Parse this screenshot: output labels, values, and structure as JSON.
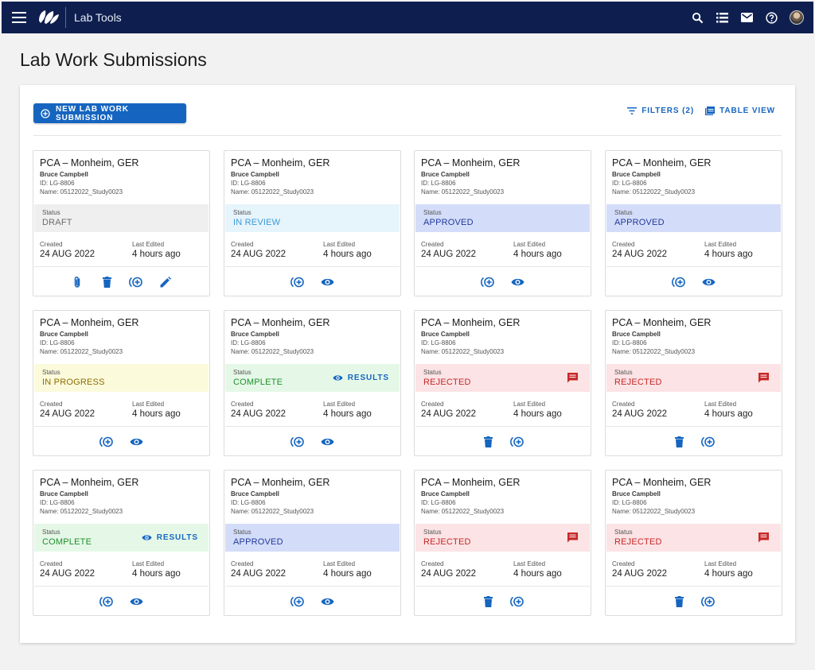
{
  "app": {
    "name": "Lab Tools",
    "menu_icon": "hamburger-menu-icon",
    "logo_icon": "leaf-logo-icon",
    "header_icons": [
      "search-icon",
      "list-icon",
      "mail-icon",
      "help-icon",
      "avatar"
    ]
  },
  "page": {
    "title": "Lab Work Submissions"
  },
  "toolbar": {
    "new_label": "NEW LAB WORK SUBMISSION",
    "filters_label": "FILTERS (2)",
    "table_view_label": "TABLE VIEW"
  },
  "labels": {
    "status": "Status",
    "created": "Created",
    "last_edited": "Last Edited",
    "results": "RESULTS"
  },
  "colors": {
    "header_bg": "#0e1f4f",
    "accent": "#1565c0",
    "draft": "#efefef",
    "in_review": "#e6f4fc",
    "approved": "#d3ddf9",
    "in_progress": "#fbfbdc",
    "complete": "#e5f8e7",
    "rejected": "#fce3e5"
  },
  "cards": [
    {
      "title": "PCA – Monheim, GER",
      "owner": "Bruce Campbell",
      "id": "ID: LG-8806",
      "name": "Name: 05122022_Study0023",
      "status": "DRAFT",
      "created": "24 AUG 2022",
      "last_edited": "4 hours ago",
      "actions": [
        "attach-icon",
        "delete-icon",
        "add-reviewer-icon",
        "edit-icon"
      ]
    },
    {
      "title": "PCA – Monheim, GER",
      "owner": "Bruce Campbell",
      "id": "ID: LG-8806",
      "name": "Name: 05122022_Study0023",
      "status": "IN REVIEW",
      "created": "24 AUG 2022",
      "last_edited": "4 hours ago",
      "actions": [
        "add-reviewer-icon",
        "view-icon"
      ]
    },
    {
      "title": "PCA – Monheim, GER",
      "owner": "Bruce Campbell",
      "id": "ID: LG-8806",
      "name": "Name: 05122022_Study0023",
      "status": "APPROVED",
      "created": "24 AUG 2022",
      "last_edited": "4 hours ago",
      "actions": [
        "add-reviewer-icon",
        "view-icon"
      ]
    },
    {
      "title": "PCA – Monheim, GER",
      "owner": "Bruce Campbell",
      "id": "ID: LG-8806",
      "name": "Name: 05122022_Study0023",
      "status": "APPROVED",
      "created": "24 AUG 2022",
      "last_edited": "4 hours ago",
      "actions": [
        "add-reviewer-icon",
        "view-icon"
      ]
    },
    {
      "title": "PCA – Monheim, GER",
      "owner": "Bruce Campbell",
      "id": "ID: LG-8806",
      "name": "Name: 05122022_Study0023",
      "status": "IN PROGRESS",
      "created": "24 AUG 2022",
      "last_edited": "4 hours ago",
      "actions": [
        "add-reviewer-icon",
        "view-icon"
      ]
    },
    {
      "title": "PCA – Monheim, GER",
      "owner": "Bruce Campbell",
      "id": "ID: LG-8806",
      "name": "Name: 05122022_Study0023",
      "status": "COMPLETE",
      "created": "24 AUG 2022",
      "last_edited": "4 hours ago",
      "actions": [
        "add-reviewer-icon",
        "view-icon"
      ]
    },
    {
      "title": "PCA – Monheim, GER",
      "owner": "Bruce Campbell",
      "id": "ID: LG-8806",
      "name": "Name: 05122022_Study0023",
      "status": "REJECTED",
      "created": "24 AUG 2022",
      "last_edited": "4 hours ago",
      "actions": [
        "delete-icon",
        "add-reviewer-icon"
      ]
    },
    {
      "title": "PCA – Monheim, GER",
      "owner": "Bruce Campbell",
      "id": "ID: LG-8806",
      "name": "Name: 05122022_Study0023",
      "status": "REJECTED",
      "created": "24 AUG 2022",
      "last_edited": "4 hours ago",
      "actions": [
        "delete-icon",
        "add-reviewer-icon"
      ]
    },
    {
      "title": "PCA – Monheim, GER",
      "owner": "Bruce Campbell",
      "id": "ID: LG-8806",
      "name": "Name: 05122022_Study0023",
      "status": "COMPLETE",
      "created": "24 AUG 2022",
      "last_edited": "4 hours ago",
      "actions": [
        "add-reviewer-icon",
        "view-icon"
      ]
    },
    {
      "title": "PCA – Monheim, GER",
      "owner": "Bruce Campbell",
      "id": "ID: LG-8806",
      "name": "Name: 05122022_Study0023",
      "status": "APPROVED",
      "created": "24 AUG 2022",
      "last_edited": "4 hours ago",
      "actions": [
        "add-reviewer-icon",
        "view-icon"
      ]
    },
    {
      "title": "PCA – Monheim, GER",
      "owner": "Bruce Campbell",
      "id": "ID: LG-8806",
      "name": "Name: 05122022_Study0023",
      "status": "REJECTED",
      "created": "24 AUG 2022",
      "last_edited": "4 hours ago",
      "actions": [
        "delete-icon",
        "add-reviewer-icon"
      ]
    },
    {
      "title": "PCA – Monheim, GER",
      "owner": "Bruce Campbell",
      "id": "ID: LG-8806",
      "name": "Name: 05122022_Study0023",
      "status": "REJECTED",
      "created": "24 AUG 2022",
      "last_edited": "4 hours ago",
      "actions": [
        "delete-icon",
        "add-reviewer-icon"
      ]
    }
  ]
}
